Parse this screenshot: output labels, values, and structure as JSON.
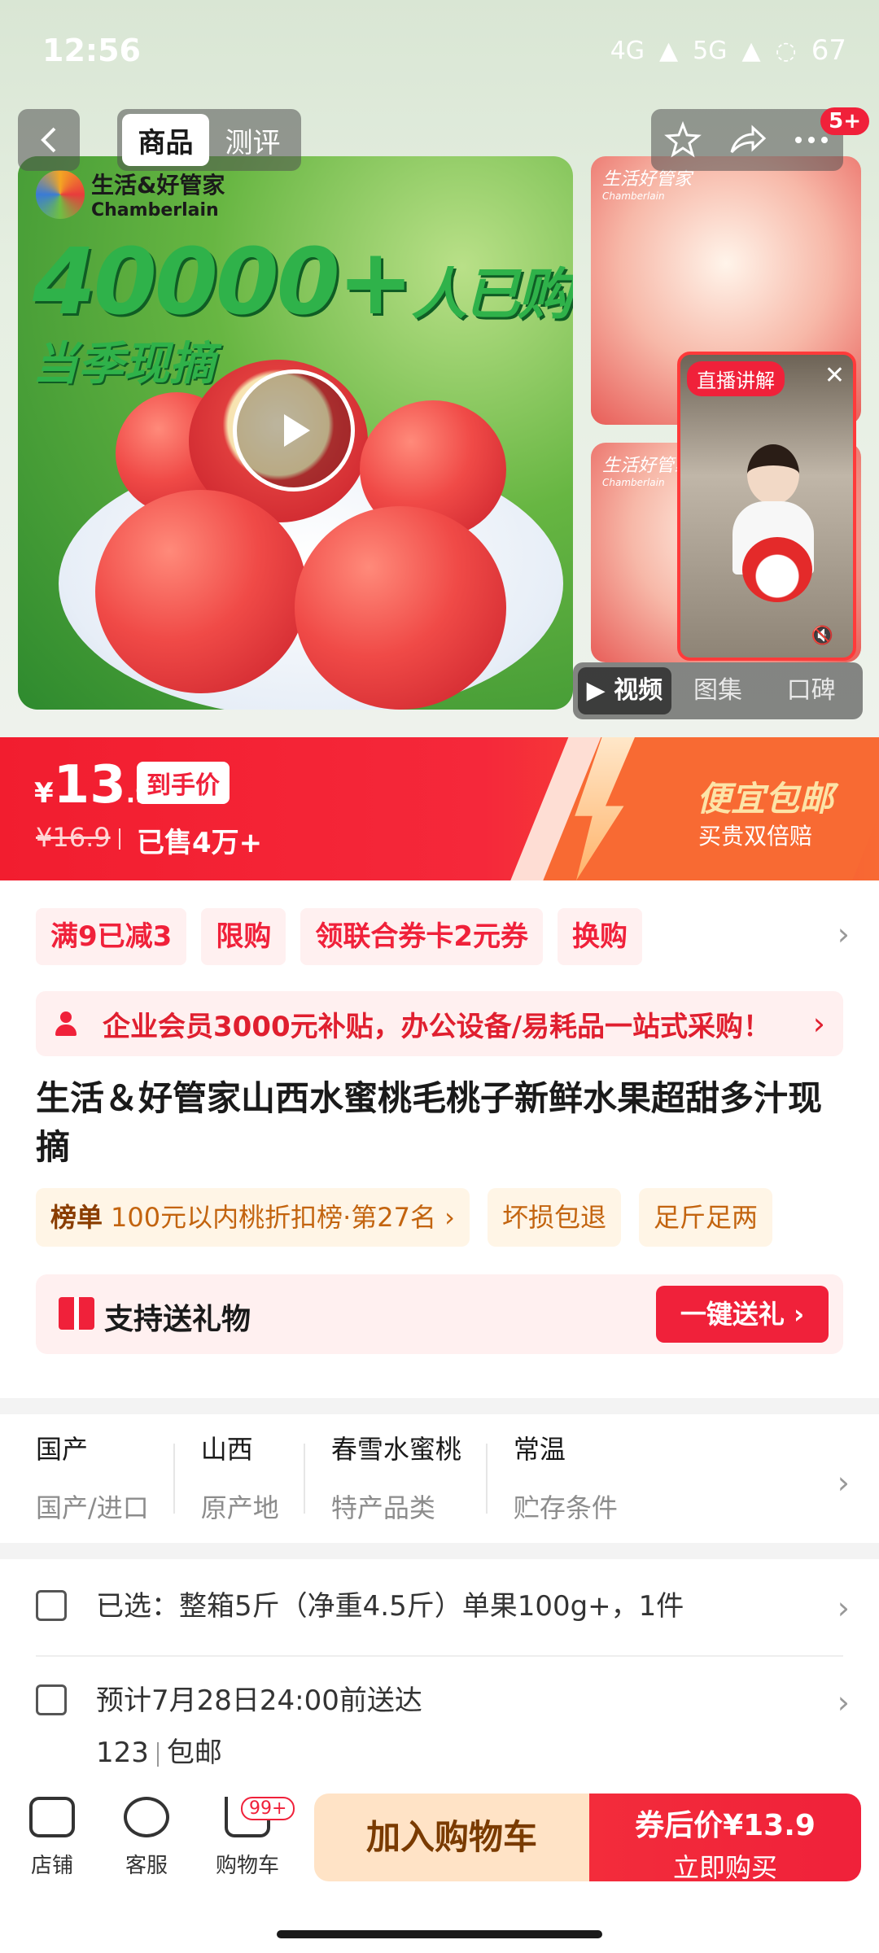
{
  "status_bar": {
    "time": "12:56",
    "signal_1": "4G",
    "signal_2": "5G",
    "battery": "67"
  },
  "nav": {
    "tabs": [
      {
        "label": "商品",
        "active": true
      },
      {
        "label": "测评",
        "active": false
      }
    ],
    "badge": "5+",
    "icons": [
      "back-icon",
      "star-icon",
      "share-icon",
      "more-icon"
    ]
  },
  "hero": {
    "brand_cn": "生活&好管家",
    "brand_en": "Chamberlain",
    "buy_count": "40000+",
    "buy_text": "人已购",
    "season_text": "当季现摘",
    "side_watermark": "生活好管家",
    "side_watermark_en": "Chamberlain",
    "live_tag": "直播讲解",
    "media_tabs": [
      {
        "label": "视频",
        "active": true
      },
      {
        "label": "图集",
        "active": false
      },
      {
        "label": "口碑",
        "active": false
      }
    ]
  },
  "price": {
    "currency": "¥",
    "now_int": "13",
    "now_dec": ".9",
    "tag": "到手价",
    "old": "¥16.9",
    "sold": "已售4万+",
    "promo_title": "便宜包邮",
    "promo_sub": "买贵双倍赔"
  },
  "promos": [
    "满9已减3",
    "限购",
    "领联合券卡2元券",
    "换购"
  ],
  "member_bar": "企业会员3000元补贴，办公设备/易耗品一站式采购！",
  "title": "生活＆好管家山西水蜜桃毛桃子新鲜水果超甜多汁现摘",
  "ranking": {
    "label": "榜单",
    "text": "100元以内桃折扣榜·第27名 ›"
  },
  "service_tags": [
    "坏损包退",
    "足斤足两"
  ],
  "gift": {
    "text": "支持送礼物",
    "button": "一键送礼 ›"
  },
  "attributes": [
    {
      "value": "国产",
      "key": "国产/进口"
    },
    {
      "value": "山西",
      "key": "原产地"
    },
    {
      "value": "春雪水蜜桃",
      "key": "特产品类"
    },
    {
      "value": "常温",
      "key": "贮存条件"
    }
  ],
  "selection": "已选：整箱5斤（净重4.5斤）单果100g+，1件",
  "delivery": {
    "eta": "预计7月28日24:00前送达",
    "code": "123",
    "shipping": "包邮"
  },
  "bottom_bar": {
    "store": "店铺",
    "service": "客服",
    "cart": "购物车",
    "cart_badge": "99+",
    "add_cart": "加入购物车",
    "buy_line1": "券后价¥13.9",
    "buy_line2": "立即购买"
  }
}
